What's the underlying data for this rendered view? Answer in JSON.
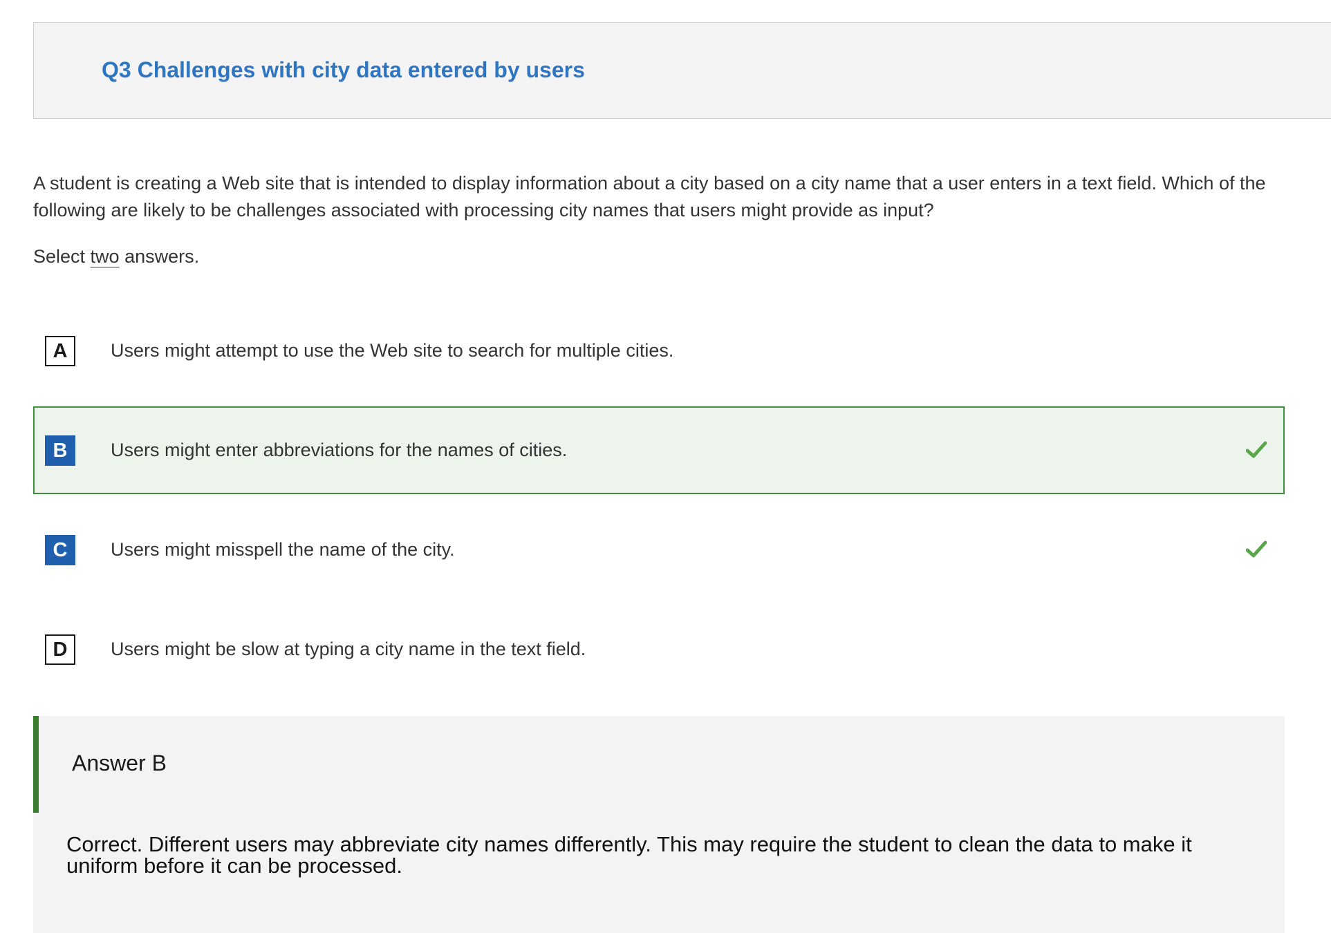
{
  "question": {
    "title": "Q3 Challenges with city data entered by users",
    "stem": "A student is creating a Web site that is intended to display information about a city based on a city name that a user enters in a text field. Which of the following are likely to be challenges associated with processing city names that users might provide as input?",
    "instruction_prefix": "Select ",
    "instruction_emphasis": "two",
    "instruction_suffix": " answers."
  },
  "options": [
    {
      "letter": "A",
      "text": "Users might attempt to use the Web site to search for multiple cities.",
      "selected": false,
      "correct": false
    },
    {
      "letter": "B",
      "text": "Users might enter abbreviations for the names of cities.",
      "selected": true,
      "correct": true
    },
    {
      "letter": "C",
      "text": "Users might misspell the name of the city.",
      "selected": false,
      "correct": true
    },
    {
      "letter": "D",
      "text": "Users might be slow at typing a city name in the text field.",
      "selected": false,
      "correct": false
    }
  ],
  "answer": {
    "title": "Answer B",
    "explanation": "Correct. Different users may abbreviate city names differently. This may require the student to clean the data to make it uniform before it can be processed."
  },
  "colors": {
    "title_blue": "#2f76c2",
    "letter_fill_blue": "#1f5fae",
    "correct_green": "#5aa64a",
    "selected_bg": "#ecf4ec",
    "selected_border": "#3f8f3f",
    "answer_bar": "#3b7d2e"
  },
  "icons": {
    "correct": "check-icon"
  }
}
